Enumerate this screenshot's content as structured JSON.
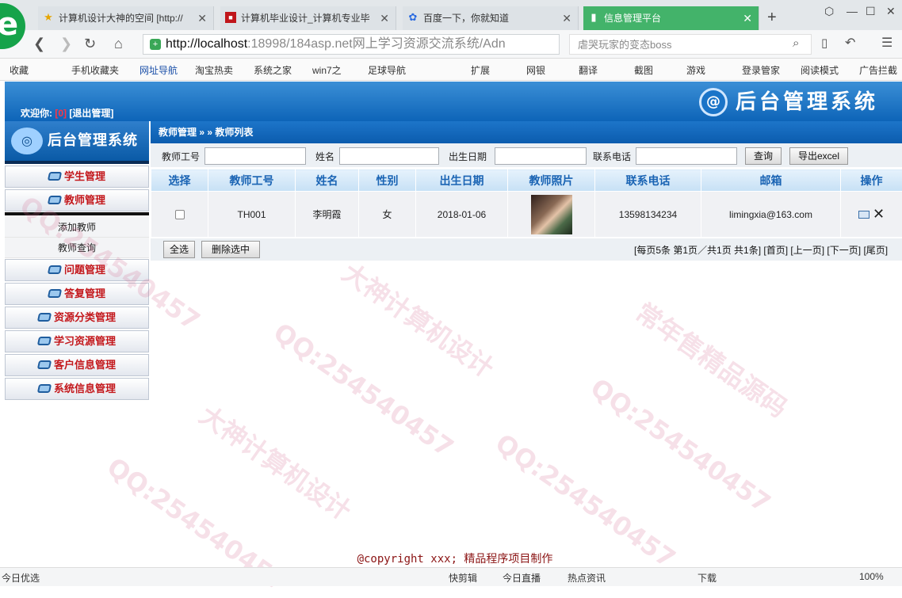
{
  "browser": {
    "tabs": [
      {
        "title": "计算机设计大神的空间 [http://",
        "icon": "star-icon"
      },
      {
        "title": "计算机毕业设计_计算机专业毕",
        "icon": "red-square-icon"
      },
      {
        "title": "百度一下，你就知道",
        "icon": "paw-icon"
      },
      {
        "title": "信息管理平台",
        "icon": "page-icon",
        "active": true
      }
    ],
    "url_host": "http://localhost",
    "url_rest": ":18998/184asp.net网上学习资源交流系统/Adn",
    "search_text": "虐哭玩家的变态boss",
    "bookmarks": [
      "收藏",
      "手机收藏夹",
      "网址导航",
      "淘宝热卖",
      "系统之家",
      "win7之",
      "足球导航",
      "扩展",
      "网银",
      "翻译",
      "截图",
      "游戏",
      "登录管家",
      "阅读模式",
      "广告拦截"
    ]
  },
  "header": {
    "welcome_label": "欢迎你:",
    "user": "[0]",
    "logout": "[退出管理]",
    "logo_title": "后台管理系统",
    "logo_mark": "@"
  },
  "sidebar": {
    "title": "后台管理系统",
    "menus": [
      {
        "label": "学生管理"
      },
      {
        "label": "教师管理",
        "subitems": [
          "添加教师",
          "教师查询"
        ]
      },
      {
        "label": "问题管理"
      },
      {
        "label": "答复管理"
      },
      {
        "label": "资源分类管理"
      },
      {
        "label": "学习资源管理"
      },
      {
        "label": "客户信息管理"
      },
      {
        "label": "系统信息管理"
      }
    ]
  },
  "main": {
    "breadcrumb": "教师管理 » » 教师列表",
    "filter": {
      "labels": [
        "教师工号",
        "姓名",
        "出生日期",
        "联系电话"
      ],
      "query_button": "查询",
      "export_button": "导出excel"
    },
    "table": {
      "columns": [
        "选择",
        "教师工号",
        "姓名",
        "性别",
        "出生日期",
        "教师照片",
        "联系电话",
        "邮箱",
        "操作"
      ],
      "rows": [
        {
          "id": "TH001",
          "name": "李明霞",
          "gender": "女",
          "birth": "2018-01-06",
          "phone": "13598134234",
          "email": "limingxia@163.com"
        }
      ]
    },
    "select_all": "全选",
    "delete_selected": "删除选中",
    "pager": {
      "summary": "[每页5条 第1页／共1页 共1条]",
      "first": "[首页]",
      "prev": "[上一页]",
      "next": "[下一页]",
      "last": "[尾页]"
    }
  },
  "footer": "@copyright xxx; 精品程序项目制作",
  "statusbar": [
    "今日优选",
    "快剪辑",
    "今日直播",
    "热点资讯",
    "下载",
    "100%"
  ],
  "watermarks": [
    "QQ:254540457",
    "大神计算机设计",
    "常年售精品源码"
  ]
}
